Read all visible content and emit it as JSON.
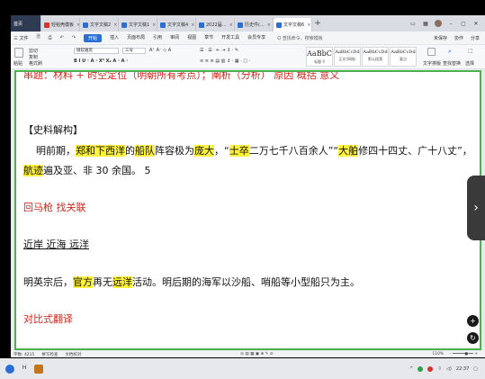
{
  "tabs": [
    {
      "label": "首页",
      "type": "home"
    },
    {
      "label": "轻稻壳模板",
      "icon": "red"
    },
    {
      "label": "文字文稿2",
      "icon": "blue"
    },
    {
      "label": "文字文稿1",
      "icon": "blue"
    },
    {
      "label": "文字文稿4",
      "icon": "blue"
    },
    {
      "label": "2022届...",
      "icon": "blue"
    },
    {
      "label": "历史件(...",
      "icon": "blue"
    },
    {
      "label": "文字文稿6",
      "icon": "blue",
      "active": true
    }
  ],
  "menu": {
    "file": "三 文件",
    "items": [
      "开始",
      "插入",
      "页面布局",
      "引用",
      "审阅",
      "视图",
      "章节",
      "开发工具",
      "会员专享"
    ],
    "search_placeholder": "Q 查找命令、搜索模板",
    "right": [
      "未保存",
      "协作",
      "分享"
    ]
  },
  "ribbon": {
    "paste": "粘贴",
    "cut": "剪切",
    "copy": "复制",
    "format_painter": "格式刷",
    "font_name": "微软雅黑",
    "font_size": "三号",
    "styles": [
      {
        "preview": "AaBbC",
        "caption": "标题 4"
      },
      {
        "preview": "AaBbCcDd",
        "caption": "正文(网格)"
      },
      {
        "preview": "AaBbCcDd",
        "caption": "默认段落"
      },
      {
        "preview": "AaBbCcDd",
        "caption": "要点"
      }
    ],
    "text_tools": "文字排版",
    "find_replace": "查找替换",
    "select": "选择"
  },
  "document": {
    "line1": "串题：材料 + 时空定位（明朝所有考点）；阐析（分析）  原因  概括  意义",
    "section_title": "【史料解构】",
    "para1_parts": [
      {
        "t": "明前期，",
        "s": ""
      },
      {
        "t": "郑和下西洋",
        "s": "hl"
      },
      {
        "t": "的",
        "s": ""
      },
      {
        "t": "船队",
        "s": "hl"
      },
      {
        "t": "阵容极为",
        "s": ""
      },
      {
        "t": "庞大",
        "s": "hl"
      },
      {
        "t": "，“",
        "s": ""
      },
      {
        "t": "士卒",
        "s": "hl"
      },
      {
        "t": "二万七千八百余人”“",
        "s": ""
      },
      {
        "t": "大舶",
        "s": "hl"
      },
      {
        "t": "修四十四丈、广十八丈”，",
        "s": ""
      }
    ],
    "para2_parts": [
      {
        "t": "航迹",
        "s": "hl"
      },
      {
        "t": "遍及亚、非 30 余国。  5",
        "s": ""
      }
    ],
    "hint": "回马枪  找关联",
    "keywords": "近岸  近海  远洋",
    "para3_parts": [
      {
        "t": "明英宗后，",
        "s": ""
      },
      {
        "t": "官方",
        "s": "hl"
      },
      {
        "t": "再无",
        "s": ""
      },
      {
        "t": "远洋",
        "s": "hl"
      },
      {
        "t": "活动。明后期的海军以沙船、哨船等小型船只为主。",
        "s": ""
      }
    ],
    "footer_hint": "对比式翻译"
  },
  "statusbar": {
    "word_count": "字数: 4215",
    "spell_check": "拼写检查",
    "doc_check": "文档校对",
    "zoom": "110%"
  },
  "taskbar": {
    "time": "22:37"
  },
  "colors": {
    "highlight": "#fff23a",
    "red_text": "#d0261c",
    "page_border": "#4caf50",
    "accent": "#2b6fd6"
  }
}
